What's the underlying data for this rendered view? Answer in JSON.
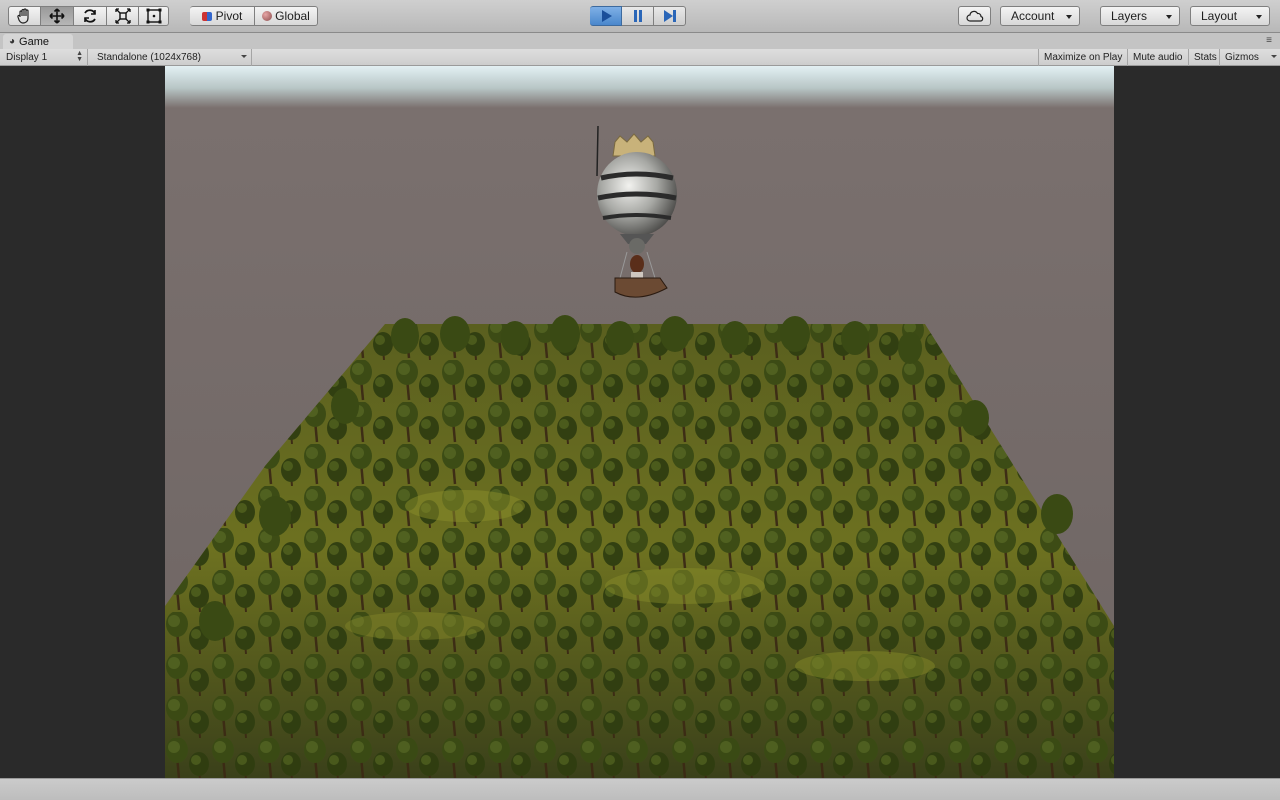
{
  "toolbar": {
    "pivot_label": "Pivot",
    "global_label": "Global",
    "account_label": "Account",
    "layers_label": "Layers",
    "layout_label": "Layout"
  },
  "panel": {
    "tab_title": "Game",
    "display": "Display 1",
    "resolution": "Standalone (1024x768)",
    "maximize": "Maximize on Play",
    "mute": "Mute audio",
    "stats": "Stats",
    "gizmos": "Gizmos"
  },
  "icons": {
    "hand": "hand-tool-icon",
    "move": "move-tool-icon",
    "rotate": "rotate-tool-icon",
    "scale": "scale-tool-icon",
    "rect": "rect-tool-icon",
    "play": "play-icon",
    "pause": "pause-icon",
    "step": "step-icon",
    "cloud": "cloud-icon"
  },
  "colors": {
    "toolbar_bg": "#c4c4c4",
    "play_active": "#4a87cc",
    "sky": "#6e6563",
    "forest": "#4f5a1a"
  }
}
